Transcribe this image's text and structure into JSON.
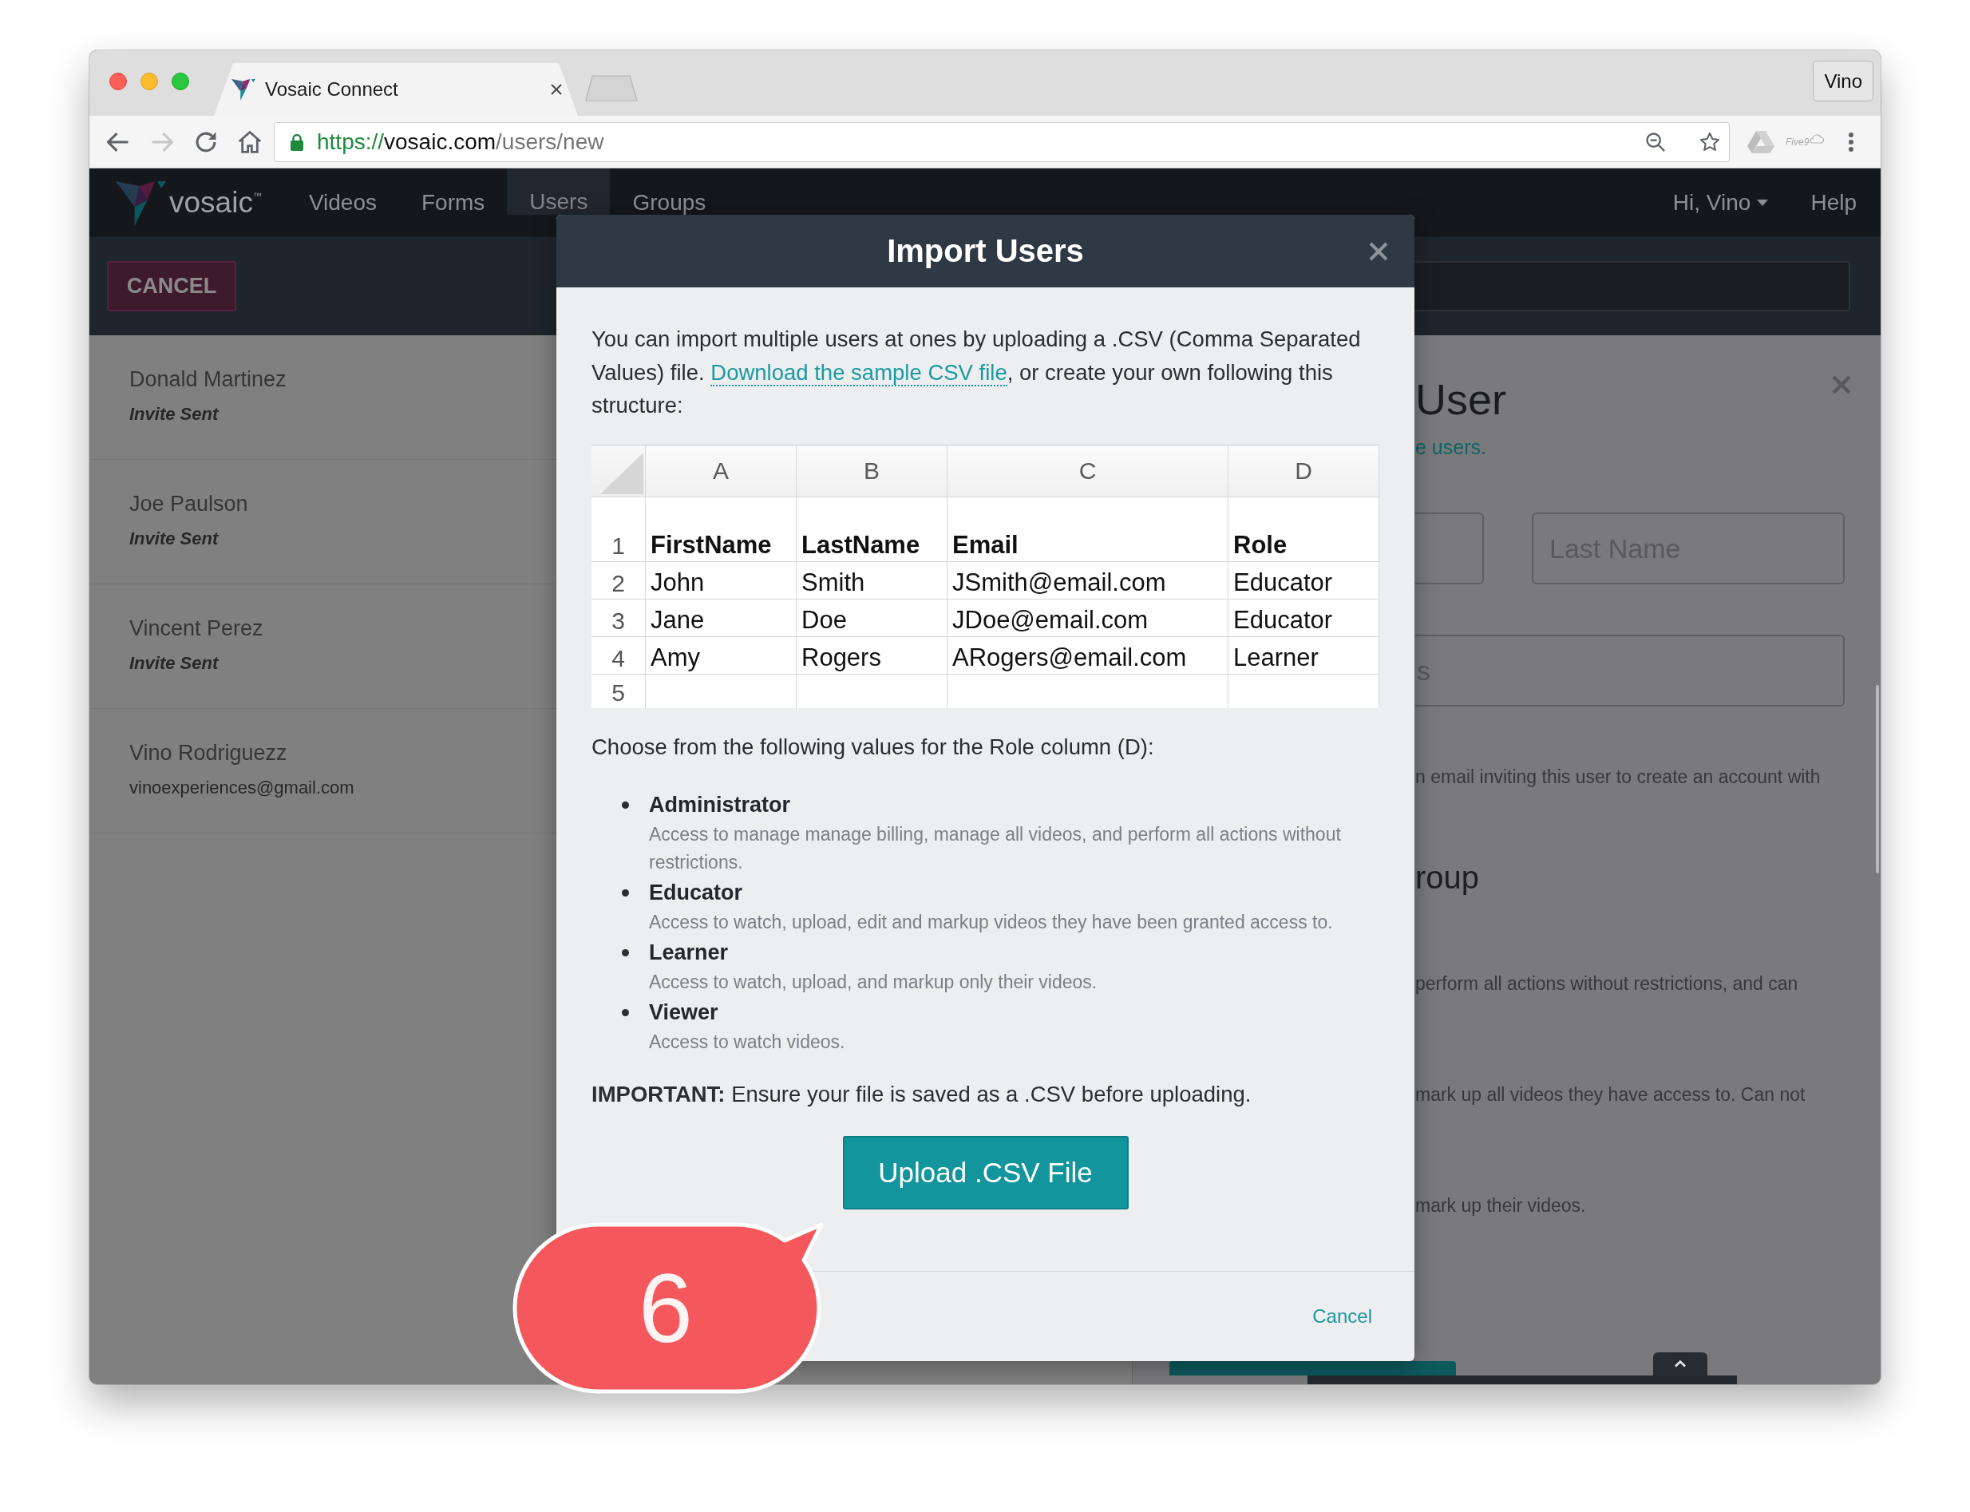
{
  "browser": {
    "tab_title": "Vosaic Connect",
    "profile": "Vino",
    "history_buttons": [
      {
        "kind": "back",
        "disabled": false
      },
      {
        "kind": "forward",
        "disabled": true
      }
    ],
    "url": {
      "scheme": "https://",
      "host": "vosaic.com",
      "path": "/users/new"
    },
    "extension_label": "Five9"
  },
  "nav": {
    "logo": "vosaic$^{™}$",
    "items": [
      {
        "label": "Videos",
        "selected": false
      },
      {
        "label": "Forms",
        "selected": false
      },
      {
        "label": "Users",
        "selected": true
      },
      {
        "label": "Groups",
        "selected": false
      }
    ],
    "user_menu": "Hi, Vino",
    "help": "Help"
  },
  "toolbar": {
    "cancel": "CANCEL"
  },
  "users": [
    {
      "name": "Donald Martinez",
      "kind": "invite",
      "detail": "Invite Sent"
    },
    {
      "name": "Joe Paulson",
      "kind": "invite",
      "detail": "Invite Sent"
    },
    {
      "name": "Vincent Perez",
      "kind": "invite",
      "detail": "Invite Sent"
    },
    {
      "name": "Vino Rodriguezz",
      "kind": "email",
      "detail": "vinoexperiences@gmail.com"
    }
  ],
  "form_panel": {
    "title": "User",
    "link": "e users.",
    "name_fields": [
      {
        "kind": "blank"
      },
      {
        "kind": "text",
        "placeholder": "Last Name"
      }
    ],
    "email_field": {
      "placeholder": "s"
    },
    "texts": [
      {
        "kind": "note",
        "text": "n email inviting this user to create an account with"
      },
      {
        "kind": "heading",
        "text": "roup"
      },
      {
        "kind": "note",
        "text": "perform all actions without restrictions, and can"
      },
      {
        "kind": "note",
        "text": "mark up all videos they have access to. Can not"
      },
      {
        "kind": "note",
        "text": "mark up their videos."
      }
    ]
  },
  "modal": {
    "title": "Import Users",
    "intro": {
      "before": "You can import multiple users at ones by uploading a .CSV (Comma Separated Values) file.",
      "link": "Download the sample CSV file",
      "after": ", or create your own following this structure:"
    },
    "spreadsheet": {
      "columns": [
        "A",
        "B",
        "C",
        "D"
      ],
      "header_row": {
        "number": "1",
        "cells": [
          "FirstName",
          "LastName",
          "Email",
          "Role"
        ]
      },
      "rows": [
        {
          "number": "2",
          "cells": [
            "John",
            "Smith",
            "JSmith@email.com",
            "Educator"
          ]
        },
        {
          "number": "3",
          "cells": [
            "Jane",
            "Doe",
            "JDoe@email.com",
            "Educator"
          ]
        },
        {
          "number": "4",
          "cells": [
            "Amy",
            "Rogers",
            "ARogers@email.com",
            "Learner"
          ]
        },
        {
          "number": "5"
        }
      ]
    },
    "roles_intro": "Choose from the following values for the Role column (D):",
    "roles": [
      {
        "name": "Administrator",
        "description": "Access to manage manage billing, manage all videos, and perform all actions without restrictions."
      },
      {
        "name": "Educator",
        "description": "Access to watch, upload, edit and markup videos they have been granted access to."
      },
      {
        "name": "Learner",
        "description": "Access to watch, upload, and markup only their videos."
      },
      {
        "name": "Viewer",
        "description": "Access to watch videos."
      }
    ],
    "note": "**IMPORTANT:** Ensure your file is saved as a .CSV before uploading.",
    "upload_button": "Upload .CSV File",
    "cancel": "Cancel"
  },
  "callout": {
    "label": "6"
  }
}
